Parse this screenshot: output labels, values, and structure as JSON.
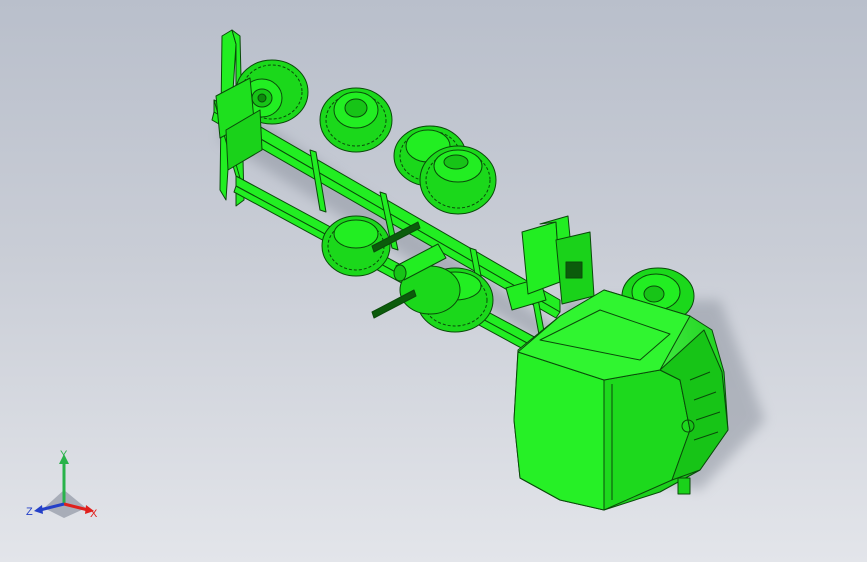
{
  "viewport": {
    "background_top": "#b9bfcb",
    "background_bottom": "#e3e5ea",
    "model_color": "#22ee22",
    "edge_color": "#0a4a0a",
    "shadow_color": "#8f95a0"
  },
  "triad": {
    "x_label": "X",
    "y_label": "Y",
    "z_label": "Z",
    "x_color": "#e0201c",
    "y_color": "#29b34a",
    "z_color": "#2440c8"
  }
}
